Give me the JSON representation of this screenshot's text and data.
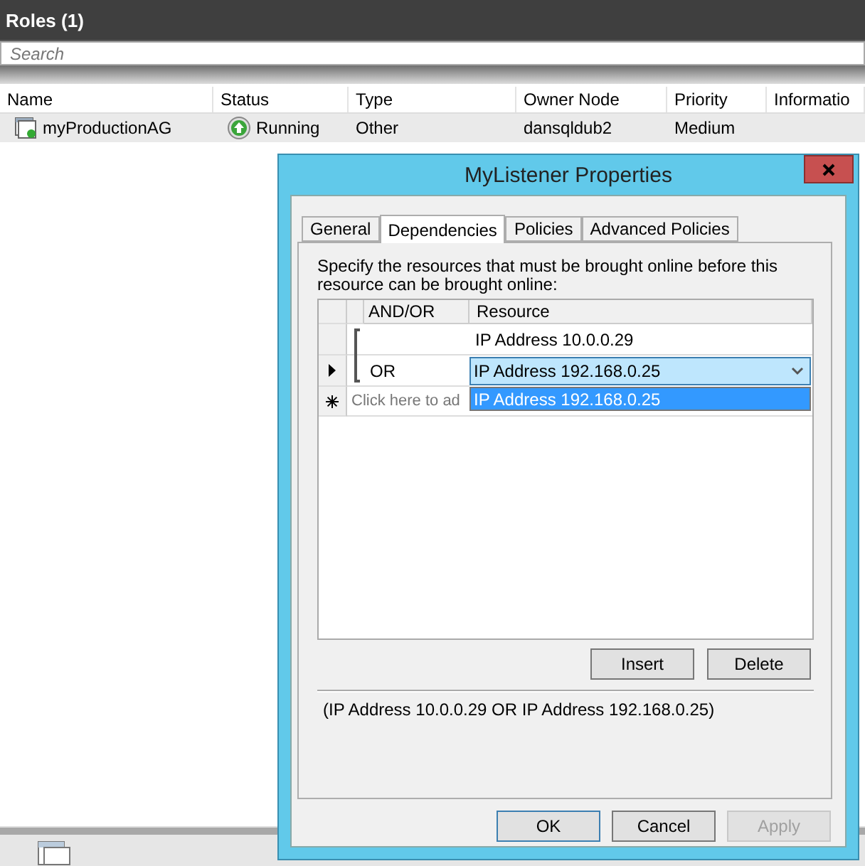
{
  "main": {
    "title": "Roles (1)",
    "search": {
      "placeholder": "Search"
    },
    "columns": [
      "Name",
      "Status",
      "Type",
      "Owner Node",
      "Priority",
      "Informatio"
    ],
    "rows": [
      {
        "name": "myProductionAG",
        "status": "Running",
        "type": "Other",
        "owner_node": "dansqldub2",
        "priority": "Medium"
      }
    ]
  },
  "dialog": {
    "title": "MyListener Properties",
    "tabs": [
      {
        "label": "General",
        "selected": false
      },
      {
        "label": "Dependencies",
        "selected": true
      },
      {
        "label": "Policies",
        "selected": false
      },
      {
        "label": "Advanced Policies",
        "selected": false
      }
    ],
    "instructions": "Specify the resources that must be brought online before this resource can be brought online:",
    "grid": {
      "columns": [
        "AND/OR",
        "Resource"
      ],
      "rows": [
        {
          "resource": "IP Address 10.0.0.29",
          "current": false,
          "editing": false
        },
        {
          "and_or": "OR",
          "resource": "IP Address 192.168.0.25",
          "current": true,
          "editing": true
        }
      ],
      "new_row": "Click here to ad",
      "dropdown": [
        {
          "label": "IP Address 192.168.0.25",
          "selected": true
        }
      ]
    },
    "grid_buttons": [
      {
        "label": "Insert",
        "disabled": false
      },
      {
        "label": "Delete",
        "disabled": false
      }
    ],
    "expression": "(IP Address 10.0.0.29 OR IP Address 192.168.0.25)",
    "buttons": [
      {
        "label": "OK",
        "default": true,
        "disabled": false
      },
      {
        "label": "Cancel",
        "default": false,
        "disabled": false
      },
      {
        "label": "Apply",
        "default": false,
        "disabled": true
      }
    ]
  }
}
